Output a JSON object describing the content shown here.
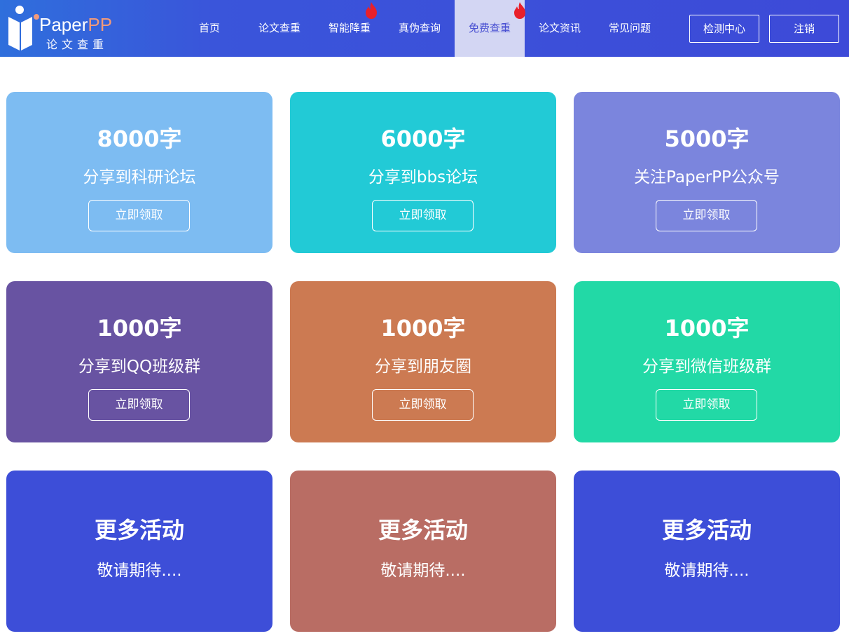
{
  "header": {
    "logo": {
      "brand_prefix": "Paper",
      "brand_suffix": "PP",
      "tagline": "论文查重"
    },
    "nav": [
      {
        "label": "首页"
      },
      {
        "label": "论文查重"
      },
      {
        "label": "智能降重",
        "hot": true
      },
      {
        "label": "真伪查询"
      },
      {
        "label": "免费查重",
        "hot": true,
        "active": true
      },
      {
        "label": "论文资讯"
      },
      {
        "label": "常见问题"
      }
    ],
    "detect_center_label": "检测中心",
    "logout_label": "注销"
  },
  "cards": [
    {
      "title": "8000字",
      "subtitle": "分享到科研论坛",
      "button": "立即领取",
      "color": "#7dbcf2"
    },
    {
      "title": "6000字",
      "subtitle": "分享到bbs论坛",
      "button": "立即领取",
      "color": "#22cad6"
    },
    {
      "title": "5000字",
      "subtitle": "关注PaperPP公众号",
      "button": "立即领取",
      "color": "#7b85dd"
    },
    {
      "title": "1000字",
      "subtitle": "分享到QQ班级群",
      "button": "立即领取",
      "color": "#6853a2"
    },
    {
      "title": "1000字",
      "subtitle": "分享到朋友圈",
      "button": "立即领取",
      "color": "#cc7a52"
    },
    {
      "title": "1000字",
      "subtitle": "分享到微信班级群",
      "button": "立即领取",
      "color": "#22d9a6"
    },
    {
      "title": "更多活动",
      "subtitle": "敬请期待....",
      "color": "#3d4ed8"
    },
    {
      "title": "更多活动",
      "subtitle": "敬请期待....",
      "color": "#b96d64"
    },
    {
      "title": "更多活动",
      "subtitle": "敬请期待....",
      "color": "#3d4ed8"
    }
  ],
  "colors": {
    "hot_icon": "#e8202a",
    "nav_active_bg": "#d3d6f3",
    "nav_active_text": "#4950d2"
  }
}
